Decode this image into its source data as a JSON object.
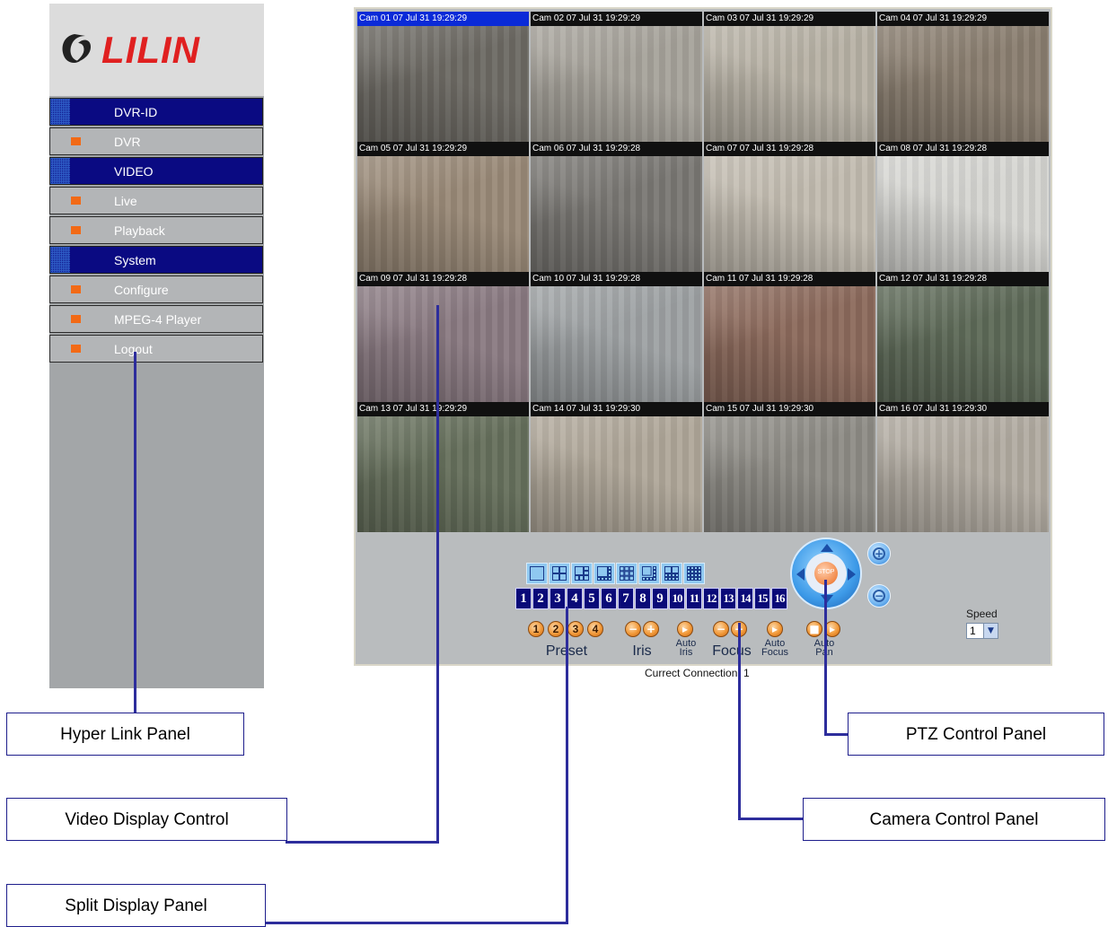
{
  "brand": {
    "logo_text": "LILIN",
    "accent": "#e02020"
  },
  "sidebar": {
    "items": [
      {
        "label": "DVR-ID",
        "kind": "header"
      },
      {
        "label": "DVR",
        "kind": "item"
      },
      {
        "label": "VIDEO",
        "kind": "header"
      },
      {
        "label": "Live",
        "kind": "item"
      },
      {
        "label": "Playback",
        "kind": "item"
      },
      {
        "label": "System",
        "kind": "header"
      },
      {
        "label": "Configure",
        "kind": "item"
      },
      {
        "label": "MPEG-4 Player",
        "kind": "item"
      },
      {
        "label": "Logout",
        "kind": "item"
      }
    ]
  },
  "cameras": [
    {
      "caption": "Cam 01 07 Jul 31 19:29:29",
      "active": true,
      "tone": "#6d6a64"
    },
    {
      "caption": "Cam 02 07 Jul 31 19:29:29",
      "tone": "#a7a39b"
    },
    {
      "caption": "Cam 03 07 Jul 31 19:29:29",
      "tone": "#b8b2a6"
    },
    {
      "caption": "Cam 04 07 Jul 31 19:29:29",
      "tone": "#8a7e70"
    },
    {
      "caption": "Cam 05 07 Jul 31 19:29:29",
      "tone": "#9a8a78"
    },
    {
      "caption": "Cam 06 07 Jul 31 19:29:28",
      "tone": "#7a7874"
    },
    {
      "caption": "Cam 07 07 Jul 31 19:29:28",
      "tone": "#c2bcb0"
    },
    {
      "caption": "Cam 08 07 Jul 31 19:29:28",
      "tone": "#d6d6d2"
    },
    {
      "caption": "Cam 09 07 Jul 31 19:29:28",
      "tone": "#8a7a82"
    },
    {
      "caption": "Cam 10 07 Jul 31 19:29:28",
      "tone": "#9ea2a4"
    },
    {
      "caption": "Cam 11 07 Jul 31 19:29:28",
      "tone": "#8c6a5c"
    },
    {
      "caption": "Cam 12 07 Jul 31 19:29:28",
      "tone": "#5e6a58"
    },
    {
      "caption": "Cam 13 07 Jul 31 19:29:29",
      "tone": "#66705c"
    },
    {
      "caption": "Cam 14 07 Jul 31 19:29:30",
      "tone": "#b0a89a"
    },
    {
      "caption": "Cam 15 07 Jul 31 19:29:30",
      "tone": "#8e8c86"
    },
    {
      "caption": "Cam 16 07 Jul 31 19:29:30",
      "tone": "#b2aca2"
    }
  ],
  "split_buttons": [
    "single",
    "quad",
    "1+5",
    "1+7",
    "9-split",
    "1+12",
    "2+8",
    "16-split"
  ],
  "camera_numbers": [
    "1",
    "2",
    "3",
    "4",
    "5",
    "6",
    "7",
    "8",
    "9",
    "10",
    "11",
    "12",
    "13",
    "14",
    "15",
    "16"
  ],
  "controls": {
    "preset_numbers": [
      "1",
      "2",
      "3",
      "4"
    ],
    "preset_label": "Preset",
    "iris_label": "Iris",
    "auto_iris_label": "Auto\nIris",
    "focus_label": "Focus",
    "auto_focus_label": "Auto\nFocus",
    "auto_pan_label": "Auto\nPan",
    "ptz_center_label": "STOP",
    "speed_label": "Speed",
    "speed_value": "1"
  },
  "status": {
    "connection_text": "Currect Connection: 1"
  },
  "callouts": {
    "hyperlink": "Hyper Link Panel",
    "video_display": "Video Display Control",
    "split_display": "Split Display Panel",
    "ptz": "PTZ Control Panel",
    "camera_control": "Camera Control Panel"
  }
}
